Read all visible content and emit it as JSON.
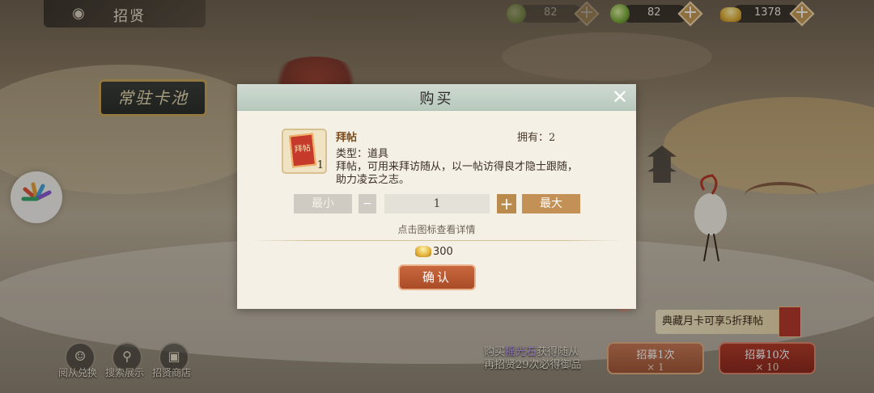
{
  "header": {
    "title": "招贤",
    "icons": {
      "logo": "eye-swirl-icon"
    }
  },
  "resources": [
    {
      "name": "jade-dim",
      "icon": "jade-orb-icon",
      "value": "82"
    },
    {
      "name": "jade",
      "icon": "jade-orb-icon",
      "value": "82"
    },
    {
      "name": "gold",
      "icon": "gold-ingot-icon",
      "value": "1378"
    }
  ],
  "pool_button": {
    "label": "常驻卡池"
  },
  "bottom_nav": [
    {
      "label": "阅从兑换",
      "icon": "person-icon"
    },
    {
      "label": "搜索展示",
      "icon": "magnifier-icon"
    },
    {
      "label": "招贤商店",
      "icon": "shop-icon"
    }
  ],
  "recruit": {
    "line1_prefix": "购买",
    "line1_highlight": "摇光石",
    "line1_suffix": "获得随从",
    "line2": "再招贤29次必得御品",
    "monthcard": "典藏月卡可享5折拜帖",
    "one": {
      "label": "招募1次",
      "cost": "× 1"
    },
    "ten": {
      "label": "招募10次",
      "cost": "× 10"
    }
  },
  "dialog": {
    "title": "购买",
    "close_label": "✕",
    "item": {
      "name": "拜帖",
      "icon_text": "拜帖",
      "quantity": "1",
      "owned": "拥有：2",
      "type": "类型：道具",
      "description": "拜帖，可用来拜访随从，以一帖访得良才隐士跟随，助力凌云之志。"
    },
    "quantity": {
      "min_label": "最小",
      "minus_label": "−",
      "value": "1",
      "plus_label": "+",
      "max_label": "最大"
    },
    "hint": "点击图标查看详情",
    "price": "300",
    "confirm_label": "确认"
  },
  "colors": {
    "dialog_bg": "#f4f0e6",
    "header_bg": "#cfdad1",
    "confirm": "#b8552f",
    "accent_gold": "#c39155"
  }
}
